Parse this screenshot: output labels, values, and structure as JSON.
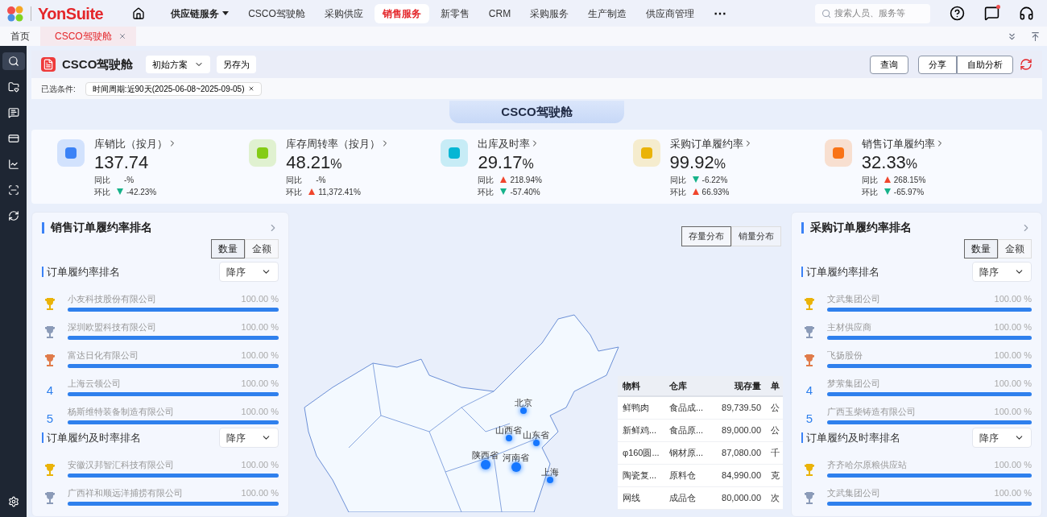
{
  "topbar": {
    "brand": "YonSuite",
    "nav": [
      {
        "label": "供应链服务",
        "selected": false,
        "kind": "dropdown"
      },
      {
        "label": "CSCO驾驶舱",
        "selected": false,
        "kind": "link"
      },
      {
        "label": "采购供应",
        "selected": false,
        "kind": "link"
      },
      {
        "label": "销售服务",
        "selected": true,
        "kind": "link"
      },
      {
        "label": "新零售",
        "selected": false,
        "kind": "link"
      },
      {
        "label": "CRM",
        "selected": false,
        "kind": "link"
      },
      {
        "label": "采购服务",
        "selected": false,
        "kind": "link"
      },
      {
        "label": "生产制造",
        "selected": false,
        "kind": "link"
      },
      {
        "label": "供应商管理",
        "selected": false,
        "kind": "link"
      }
    ],
    "more": "⋯",
    "search": {
      "placeholder": "搜索人员、服务等"
    },
    "messages_unread": true
  },
  "tabs": [
    {
      "label": "首页",
      "selected": false,
      "closable": false
    },
    {
      "label": "CSCO驾驶舱",
      "selected": true,
      "closable": true
    }
  ],
  "sidebar": {
    "items": [
      {
        "selected": true
      },
      {
        "selected": false
      },
      {
        "selected": false
      },
      {
        "selected": false
      },
      {
        "selected": false
      },
      {
        "selected": false
      },
      {
        "selected": false
      }
    ]
  },
  "header": {
    "title": "CSCO驾驶舱",
    "scheme": "初始方案",
    "save_as": "另存为",
    "actions": [
      "查询",
      "分享",
      "自助分析"
    ]
  },
  "conditions": {
    "label": "已选条件:",
    "tags": [
      "时间周期:近90天(2025-06-08~2025-09-05)"
    ]
  },
  "banner": {
    "title": "CSCO驾驶舱"
  },
  "kpis": [
    {
      "label": "库销比（按月）",
      "value": "137.74",
      "color": "#3b82f6",
      "yoy": {
        "label": "同比",
        "value": "-%"
      },
      "mom": {
        "label": "环比",
        "value": "-42.23%",
        "kind": "down"
      }
    },
    {
      "label": "库存周转率（按月）",
      "value": "48.21",
      "unit": "%",
      "color": "#84cc16",
      "yoy": {
        "label": "同比",
        "value": "-%"
      },
      "mom": {
        "label": "环比",
        "value": "11,372.41%",
        "kind": "up"
      }
    },
    {
      "label": "出库及时率",
      "value": "29.17",
      "unit": "%",
      "color": "#06b6d4",
      "yoy": {
        "label": "同比",
        "value": "218.94%",
        "kind": "up"
      },
      "mom": {
        "label": "环比",
        "value": "-57.40%",
        "kind": "down"
      }
    },
    {
      "label": "采购订单履约率",
      "value": "99.92",
      "unit": "%",
      "color": "#eab308",
      "yoy": {
        "label": "同比",
        "value": "-6.22%",
        "kind": "down"
      },
      "mom": {
        "label": "环比",
        "value": "66.93%",
        "kind": "up"
      }
    },
    {
      "label": "销售订单履约率",
      "value": "32.33",
      "unit": "%",
      "color": "#f97316",
      "yoy": {
        "label": "同比",
        "value": "268.15%",
        "kind": "up"
      },
      "mom": {
        "label": "环比",
        "value": "-65.97%",
        "kind": "down"
      }
    }
  ],
  "left_panel": {
    "title": "销售订单履约率排名",
    "toggle": [
      {
        "label": "数量",
        "selected": true
      },
      {
        "label": "金额",
        "selected": false
      }
    ],
    "sections": [
      {
        "title": "订单履约率排名",
        "sort": "降序",
        "rows": [
          {
            "kind": "gold",
            "name": "小友科技股份有限公司",
            "value": "100.00 %",
            "level": 1
          },
          {
            "kind": "silver",
            "name": "深圳欧盟科技有限公司",
            "value": "100.00 %",
            "level": 1
          },
          {
            "kind": "bronze",
            "name": "富达日化有限公司",
            "value": "100.00 %",
            "level": 1
          },
          {
            "kind": "number",
            "rank": "4",
            "name": "上海云领公司",
            "value": "100.00 %",
            "level": 1
          },
          {
            "kind": "number",
            "rank": "5",
            "name": "杨斯维特装备制造有限公司",
            "value": "100.00 %",
            "level": 1
          }
        ]
      },
      {
        "title": "订单履约及时率排名",
        "sort": "降序",
        "rows": [
          {
            "kind": "gold",
            "name": "安徽汉邦智汇科技有限公司",
            "value": "100.00 %",
            "level": 1
          },
          {
            "kind": "silver",
            "name": "广西祥和顺远洋捕捞有限公司",
            "value": "100.00 %",
            "level": 1
          }
        ]
      }
    ]
  },
  "map_panel": {
    "toggle": [
      {
        "label": "存量分布",
        "selected": true
      },
      {
        "label": "销量分布",
        "selected": false
      }
    ],
    "points": [
      {
        "label": "北京",
        "kind": "small"
      },
      {
        "label": "山西省",
        "kind": "small"
      },
      {
        "label": "山东省",
        "kind": "small"
      },
      {
        "label": "河南省",
        "kind": "large"
      },
      {
        "label": "陕西省",
        "kind": "large"
      },
      {
        "label": "上海",
        "kind": "small"
      }
    ],
    "table": {
      "columns": [
        "物料",
        "仓库",
        "现存量",
        "单"
      ],
      "rows": [
        [
          "鲜鸭肉",
          "食品成...",
          "89,739.50",
          "公"
        ],
        [
          "新鲜鸡...",
          "食品原...",
          "89,000.00",
          "公"
        ],
        [
          "φ160圆...",
          "钢材原...",
          "87,080.00",
          "千"
        ],
        [
          "陶瓷复...",
          "原料仓",
          "84,990.00",
          "克"
        ],
        [
          "网线",
          "成品仓",
          "80,000.00",
          "次"
        ]
      ]
    }
  },
  "right_panel": {
    "title": "采购订单履约率排名",
    "toggle": [
      {
        "label": "数量",
        "selected": true
      },
      {
        "label": "金额",
        "selected": false
      }
    ],
    "sections": [
      {
        "title": "订单履约率排名",
        "sort": "降序",
        "rows": [
          {
            "kind": "gold",
            "name": "文武集团公司",
            "value": "100.00 %",
            "level": 1
          },
          {
            "kind": "silver",
            "name": "主材供应商",
            "value": "100.00 %",
            "level": 1
          },
          {
            "kind": "bronze",
            "name": "飞扬股份",
            "value": "100.00 %",
            "level": 1
          },
          {
            "kind": "number",
            "rank": "4",
            "name": "梦萦集团公司",
            "value": "100.00 %",
            "level": 1
          },
          {
            "kind": "number",
            "rank": "5",
            "name": "广西玉柴铸造有限公司",
            "value": "100.00 %",
            "level": 1
          }
        ]
      },
      {
        "title": "订单履约及时率排名",
        "sort": "降序",
        "rows": [
          {
            "kind": "gold",
            "name": "齐齐哈尔原粮供应站",
            "value": "100.00 %",
            "level": 1
          },
          {
            "kind": "silver",
            "name": "文武集团公司",
            "value": "100.00 %",
            "level": 1
          }
        ]
      }
    ]
  }
}
